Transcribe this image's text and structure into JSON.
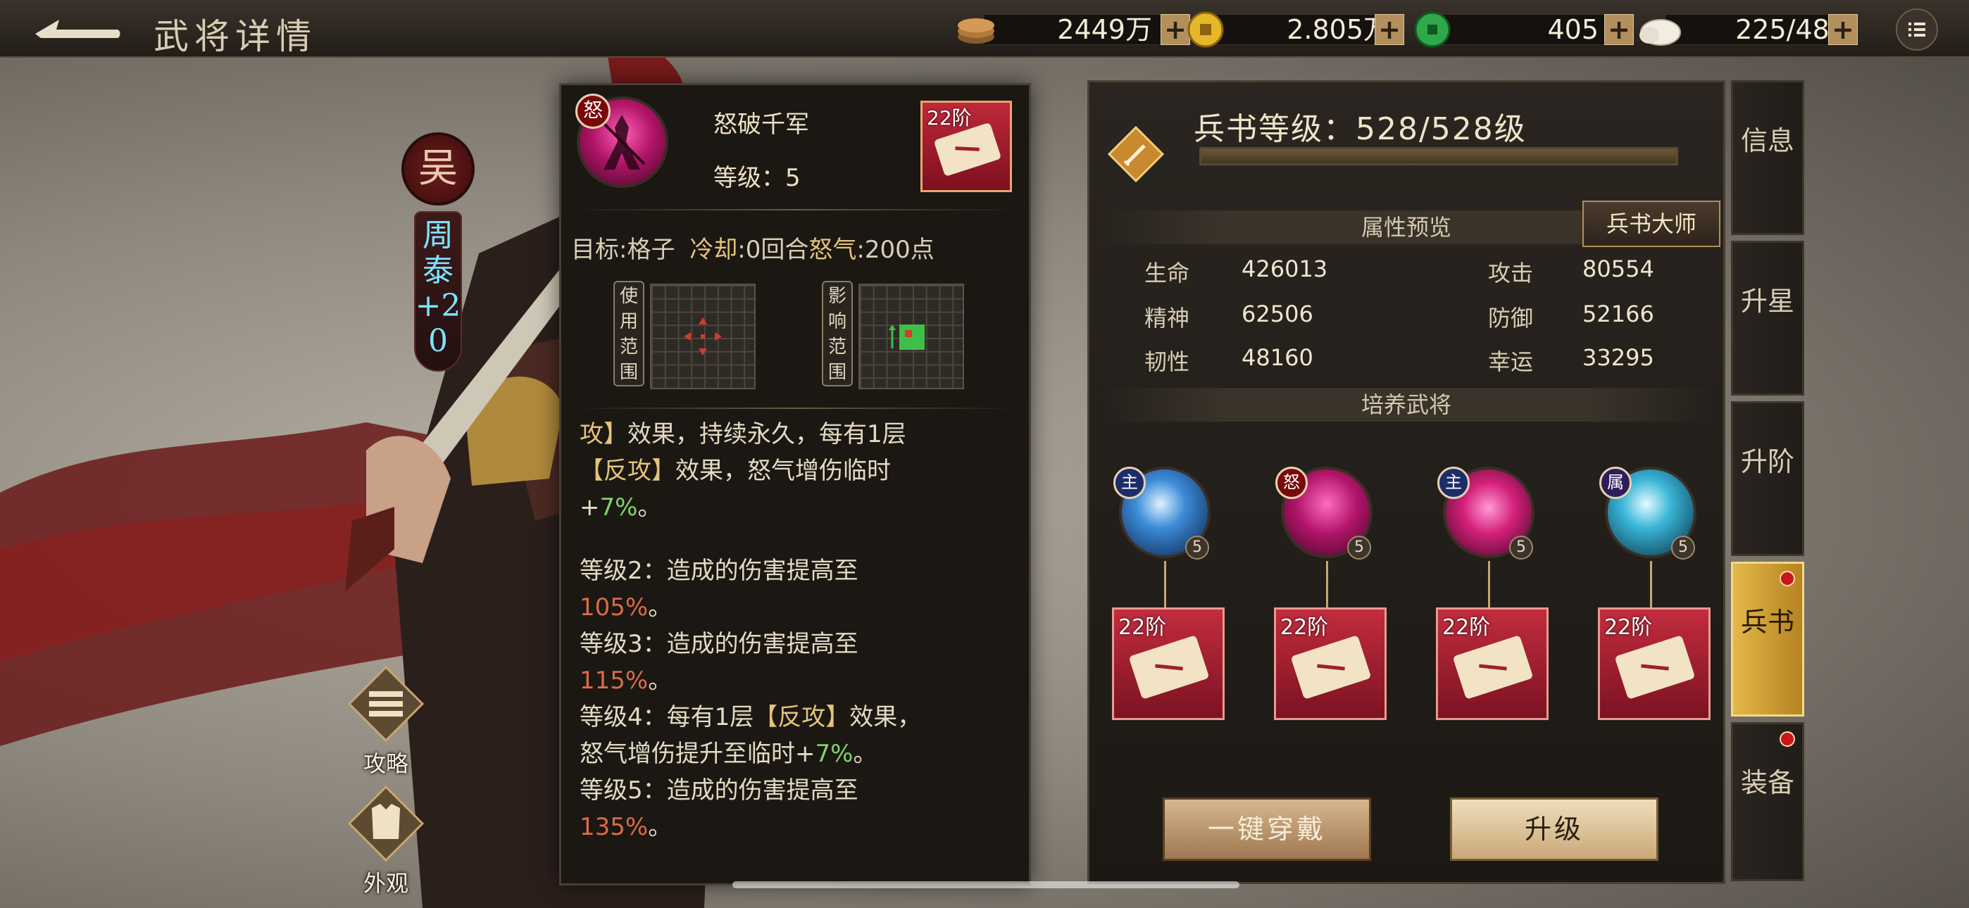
{
  "top_bar": {
    "title": "武将详情",
    "currencies": [
      {
        "icon": "copper-coins-icon",
        "value": "2449万"
      },
      {
        "icon": "gold-coin-icon",
        "value": "2.805万"
      },
      {
        "icon": "jade-coin-icon",
        "value": "405"
      },
      {
        "icon": "steamed-bun-icon",
        "value": "225/480"
      }
    ],
    "plus_label": "+"
  },
  "hero": {
    "faction": "吴",
    "name": "周泰+20"
  },
  "side_buttons": {
    "strategy": "攻略",
    "appearance": "外观"
  },
  "skill_popup": {
    "tag": "怒",
    "name": "怒破千军",
    "level_text": "等级：5",
    "book_rank": "22阶",
    "target_label": "目标",
    "target_value": "格子",
    "cooldown_label": "冷却",
    "cooldown_value": "0回合",
    "rage_label": "怒气",
    "rage_value": "200点",
    "use_range_label": "使用范围",
    "effect_range_label": "影响范围",
    "description": [
      {
        "parts": [
          {
            "text": "攻】",
            "style": "bracket"
          },
          {
            "text": "效果，持续永久，每有1层",
            "style": ""
          }
        ]
      },
      {
        "parts": [
          {
            "text": "【反攻】",
            "style": "bracket"
          },
          {
            "text": "效果，怒气增伤临时",
            "style": ""
          }
        ]
      },
      {
        "parts": [
          {
            "text": "+",
            "style": ""
          },
          {
            "text": "7%",
            "style": "green"
          },
          {
            "text": "。",
            "style": ""
          }
        ]
      },
      {
        "gap": true
      },
      {
        "parts": [
          {
            "text": "等级2：造成的伤害提高至",
            "style": ""
          }
        ]
      },
      {
        "parts": [
          {
            "text": "105%",
            "style": "pct"
          },
          {
            "text": "。",
            "style": ""
          }
        ]
      },
      {
        "parts": [
          {
            "text": "等级3：造成的伤害提高至",
            "style": ""
          }
        ]
      },
      {
        "parts": [
          {
            "text": "115%",
            "style": "pct"
          },
          {
            "text": "。",
            "style": ""
          }
        ]
      },
      {
        "parts": [
          {
            "text": "等级4：每有1层",
            "style": ""
          },
          {
            "text": "【反攻】",
            "style": "bracket"
          },
          {
            "text": "效果，",
            "style": ""
          }
        ]
      },
      {
        "parts": [
          {
            "text": "怒气增伤提升至临时+",
            "style": ""
          },
          {
            "text": "7%",
            "style": "green"
          },
          {
            "text": "。",
            "style": ""
          }
        ]
      },
      {
        "parts": [
          {
            "text": "等级5：造成的伤害提高至",
            "style": ""
          }
        ]
      },
      {
        "parts": [
          {
            "text": "135%",
            "style": "pct"
          },
          {
            "text": "。",
            "style": ""
          }
        ]
      }
    ]
  },
  "panel": {
    "book_level": "兵书等级：528/528级",
    "book_level_progress": 1.0,
    "attr_header": "属性预览",
    "master_button": "兵书大师",
    "attributes": [
      {
        "label": "生命",
        "value": "426013"
      },
      {
        "label": "攻击",
        "value": "80554"
      },
      {
        "label": "精神",
        "value": "62506"
      },
      {
        "label": "防御",
        "value": "52166"
      },
      {
        "label": "韧性",
        "value": "48160"
      },
      {
        "label": "幸运",
        "value": "33295"
      }
    ],
    "train_header": "培养武将",
    "trainees": [
      {
        "tag": "主",
        "tag_color": "#1d2d6a",
        "orb": "blue-sphere-skill-icon",
        "level": "5",
        "rank": "22阶"
      },
      {
        "tag": "怒",
        "tag_color": "#7a0a0a",
        "orb": "warrior-rage-skill-icon",
        "level": "5",
        "rank": "22阶"
      },
      {
        "tag": "主",
        "tag_color": "#1d2d6a",
        "orb": "pink-slash-skill-icon",
        "level": "5",
        "rank": "22阶"
      },
      {
        "tag": "属",
        "tag_color": "#2d1d5a",
        "orb": "cyan-orb-skill-icon",
        "level": "5",
        "rank": "22阶"
      }
    ],
    "wear_all_button": "一键穿戴",
    "upgrade_button": "升级"
  },
  "tabs": [
    {
      "label": "信息",
      "active": false,
      "dot": false
    },
    {
      "label": "升星",
      "active": false,
      "dot": false
    },
    {
      "label": "升阶",
      "active": false,
      "dot": false
    },
    {
      "label": "兵书",
      "active": true,
      "dot": true
    },
    {
      "label": "装备",
      "active": false,
      "dot": true
    }
  ]
}
